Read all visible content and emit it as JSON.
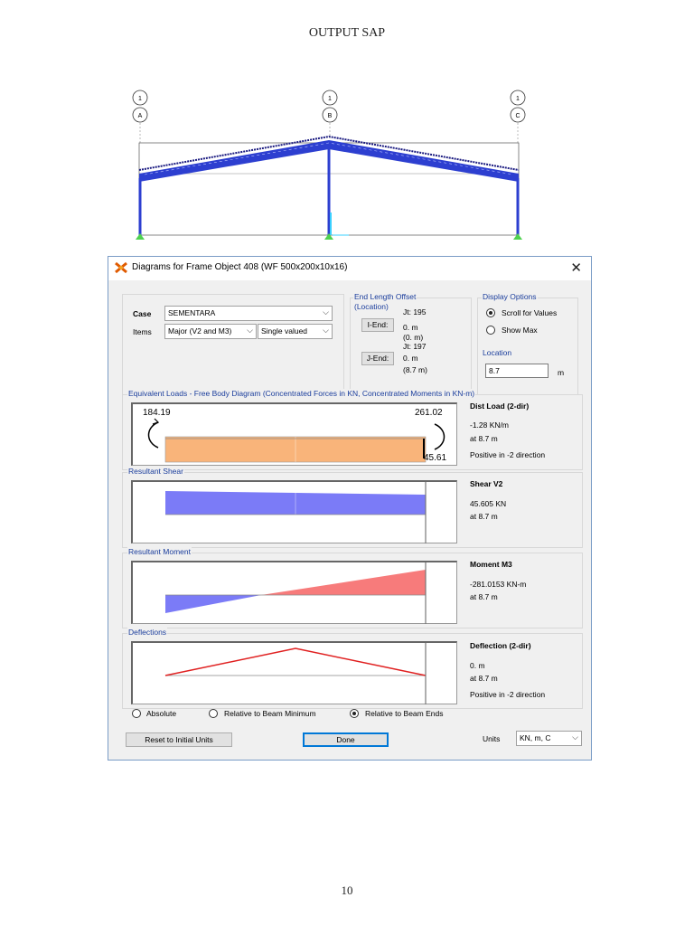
{
  "document": {
    "title": "OUTPUT SAP",
    "page_number": "10"
  },
  "model": {
    "grid_bubbles": [
      {
        "top": "1",
        "bottom": "A"
      },
      {
        "top": "1",
        "bottom": "B"
      },
      {
        "top": "1",
        "bottom": "C"
      }
    ]
  },
  "window": {
    "title": "Diagrams for Frame Object 408  (WF 500x200x10x16)",
    "close": "✕"
  },
  "case_group": {
    "case_label": "Case",
    "case_value": "SEMENTARA",
    "items_label": "Items",
    "items_value": "Major (V2 and M3)",
    "valued_value": "Single valued"
  },
  "end_length_offset": {
    "title": "End Length Offset",
    "subtitle": "(Location)",
    "i_end_button": "I-End:",
    "i_jt": "Jt:  195",
    "i_val": "0. m",
    "i_loc": "(0. m)",
    "j_end_button": "J-End:",
    "j_jt": "Jt:  197",
    "j_val": "0. m",
    "j_loc": "(8.7 m)"
  },
  "display_options": {
    "title": "Display Options",
    "scroll": "Scroll for Values",
    "show_max": "Show Max",
    "selected": "scroll"
  },
  "location": {
    "title": "Location",
    "value": "8.7",
    "unit": "m"
  },
  "equivalent_loads": {
    "title": "Equivalent Loads - Free Body Diagram  (Concentrated Forces in KN, Concentrated Moments in KN-m)",
    "left_moment": "184.19",
    "right_moment": "261.02",
    "right_force": "45.61",
    "load_color": "#f9b47a"
  },
  "dist_load": {
    "title": "Dist Load (2-dir)",
    "value": "-1.28 KN/m",
    "at": "at 8.7 m",
    "note": "Positive in -2 direction"
  },
  "shear": {
    "title": "Resultant Shear",
    "result_title": "Shear V2",
    "value": "45.605 KN",
    "at": "at 8.7 m",
    "fill_color": "#7b7bf7"
  },
  "moment": {
    "title": "Resultant Moment",
    "result_title": "Moment M3",
    "value": "-281.0153 KN-m",
    "at": "at 8.7 m",
    "neg_color": "#7b7bf7",
    "pos_color": "#f77b7b"
  },
  "deflection": {
    "title": "Deflections",
    "result_title": "Deflection (2-dir)",
    "value": "0. m",
    "at": "at 8.7 m",
    "note": "Positive in -2 direction",
    "line_color": "#e02020"
  },
  "deflection_mode": {
    "absolute": "Absolute",
    "relative_min": "Relative to Beam Minimum",
    "relative_ends": "Relative to Beam Ends",
    "selected": "relative_ends"
  },
  "footer": {
    "reset_button": "Reset to Initial Units",
    "done_button": "Done",
    "units_label": "Units",
    "units_value": "KN, m, C"
  }
}
